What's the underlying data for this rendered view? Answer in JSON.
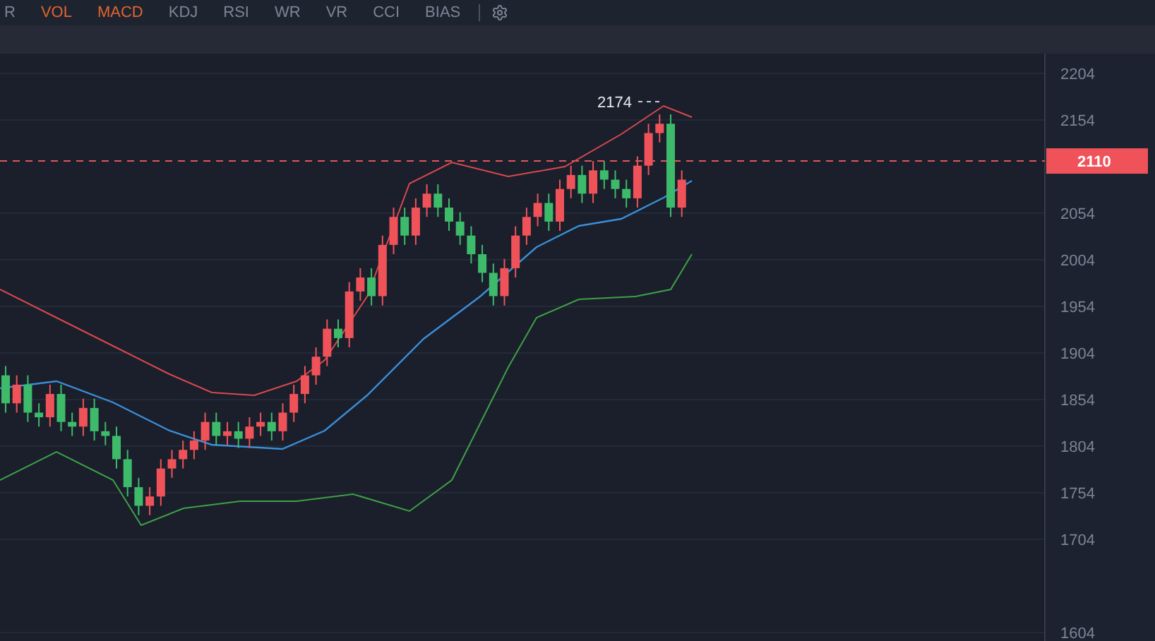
{
  "indicator_tabs": [
    {
      "label": "R",
      "selected": false
    },
    {
      "label": "VOL",
      "selected": true
    },
    {
      "label": "MACD",
      "selected": true
    },
    {
      "label": "KDJ",
      "selected": false
    },
    {
      "label": "RSI",
      "selected": false
    },
    {
      "label": "WR",
      "selected": false
    },
    {
      "label": "VR",
      "selected": false
    },
    {
      "label": "CCI",
      "selected": false
    },
    {
      "label": "BIAS",
      "selected": false
    }
  ],
  "chart": {
    "y_ticks": [
      "2204",
      "2154",
      "2054",
      "2004",
      "1954",
      "1904",
      "1854",
      "1804",
      "1754",
      "1704",
      "1604"
    ],
    "current_price": "2110",
    "high_label": "2174"
  }
}
